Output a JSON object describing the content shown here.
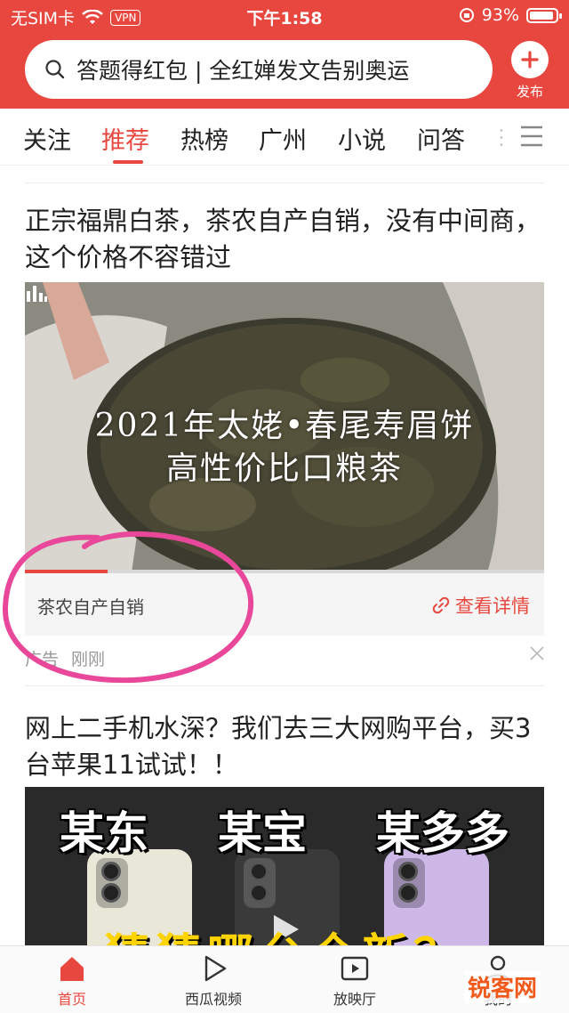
{
  "status_bar": {
    "carrier": "无SIM卡",
    "vpn": "VPN",
    "time": "下午1:58",
    "battery": "93%"
  },
  "search": {
    "text": "答题得红包 | 全红婵发文告别奥运"
  },
  "publish": {
    "label": "发布"
  },
  "tabs": [
    {
      "label": "关注"
    },
    {
      "label": "推荐"
    },
    {
      "label": "热榜"
    },
    {
      "label": "广州"
    },
    {
      "label": "小说"
    },
    {
      "label": "问答"
    }
  ],
  "feed": {
    "ad": {
      "title": "正宗福鼎白茶，茶农自产自销，没有中间商，这个价格不容错过",
      "caption_line1": "2021年太姥•春尾寿眉饼",
      "caption_line2": "高性价比口粮茶",
      "bar_text": "茶农自产自销",
      "detail_link": "查看详情",
      "progress": 0.16,
      "tag": "广告",
      "time": "刚刚"
    },
    "article2": {
      "title": "网上二手机水深？我们去三大网购平台，买3台苹果11试试！！",
      "thumb_words": [
        "某东",
        "某宝",
        "某多多"
      ],
      "thumb_bottom": "猜猜哪台全新？"
    }
  },
  "bottom_nav": [
    {
      "label": "首页"
    },
    {
      "label": "西瓜视频"
    },
    {
      "label": "放映厅"
    },
    {
      "label": "我的"
    }
  ],
  "watermark": "锐客网",
  "colors": {
    "accent": "#e8473f",
    "annotation": "#e8479a"
  }
}
